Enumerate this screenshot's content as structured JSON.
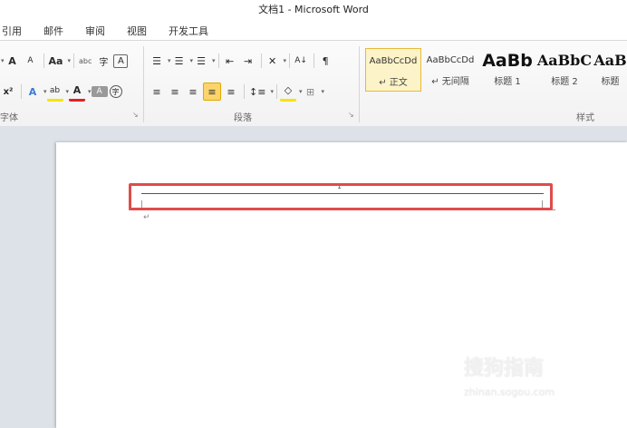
{
  "window": {
    "title": "文档1 - Microsoft Word"
  },
  "tabs": [
    {
      "label": "引用"
    },
    {
      "label": "邮件"
    },
    {
      "label": "审阅"
    },
    {
      "label": "视图"
    },
    {
      "label": "开发工具"
    }
  ],
  "font_group": {
    "label": "字体",
    "grow_font": "A",
    "shrink_font": "A",
    "change_case": "Aa",
    "phonetic": "abc",
    "enclose": "字",
    "char_border": "A",
    "superscript": "x²",
    "text_effect": "A",
    "highlight": "ab",
    "font_color": "A",
    "char_shading": "A",
    "enclose_char": "字"
  },
  "paragraph_group": {
    "label": "段落",
    "bullets": "☰",
    "numbering": "☰",
    "multilevel": "☰",
    "decrease_indent": "⇤",
    "increase_indent": "⇥",
    "chinese_layout": "✕",
    "sort": "A↓",
    "show_marks": "¶",
    "align_left": "≡",
    "center": "≡",
    "align_right": "≡",
    "justify": "≡",
    "distributed": "≡",
    "line_spacing": "↕≡",
    "shading": "◇",
    "borders": "⊞"
  },
  "styles_group": {
    "label": "样式",
    "styles": [
      {
        "preview": "AaBbCcDd",
        "name": "↵ 正文",
        "selected": true
      },
      {
        "preview": "AaBbCcDd",
        "name": "↵ 无间隔",
        "selected": false
      },
      {
        "preview": "AaBb",
        "name": "标题 1",
        "selected": false
      },
      {
        "preview": "AaBbC",
        "name": "标题 2",
        "selected": false
      },
      {
        "preview": "AaB",
        "name": "标题",
        "selected": false
      }
    ]
  },
  "document": {
    "page_number": "1",
    "paragraph_mark": "↵"
  },
  "watermark": {
    "brand": "搜狗指南",
    "url": "zhinan.sogou.com"
  },
  "colors": {
    "highlight_border": "#e04b4b",
    "selected_style_bg": "#fdf3c8",
    "doc_background": "#dde1e8"
  }
}
